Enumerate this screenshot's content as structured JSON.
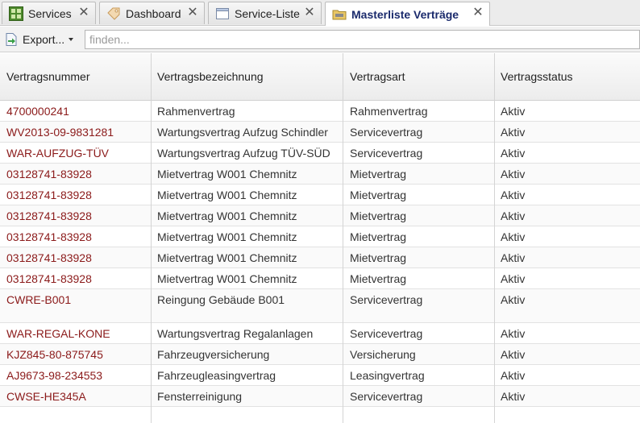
{
  "tabs": [
    {
      "label": "Services",
      "icon": "grid-icon",
      "active": false
    },
    {
      "label": "Dashboard",
      "icon": "tag-icon",
      "active": false
    },
    {
      "label": "Service-Liste",
      "icon": "window-icon",
      "active": false
    },
    {
      "label": "Masterliste Verträge",
      "icon": "folder-icon",
      "active": true
    }
  ],
  "toolbar": {
    "export_label": "Export...",
    "search_placeholder": "finden..."
  },
  "table": {
    "columns": [
      "Vertragsnummer",
      "Vertragsbezeichnung",
      "Vertragsart",
      "Vertragsstatus"
    ],
    "rows": [
      [
        "4700000241",
        "Rahmenvertrag",
        "Rahmenvertrag",
        "Aktiv"
      ],
      [
        "WV2013-09-9831281",
        "Wartungsvertrag Aufzug Schindler",
        "Servicevertrag",
        "Aktiv"
      ],
      [
        "WAR-AUFZUG-TÜV",
        "Wartungsvertrag Aufzug TÜV-SÜD",
        "Servicevertrag",
        "Aktiv"
      ],
      [
        "03128741-83928",
        "Mietvertrag W001 Chemnitz",
        "Mietvertrag",
        "Aktiv"
      ],
      [
        "03128741-83928",
        "Mietvertrag W001 Chemnitz",
        "Mietvertrag",
        "Aktiv"
      ],
      [
        "03128741-83928",
        "Mietvertrag W001 Chemnitz",
        "Mietvertrag",
        "Aktiv"
      ],
      [
        "03128741-83928",
        "Mietvertrag W001 Chemnitz",
        "Mietvertrag",
        "Aktiv"
      ],
      [
        "03128741-83928",
        "Mietvertrag W001 Chemnitz",
        "Mietvertrag",
        "Aktiv"
      ],
      [
        "03128741-83928",
        "Mietvertrag W001 Chemnitz",
        "Mietvertrag",
        "Aktiv"
      ],
      [
        "CWRE-B001",
        "Reingung Gebäude B001",
        "Servicevertrag",
        "Aktiv"
      ],
      [
        "WAR-REGAL-KONE",
        "Wartungsvertrag Regalanlagen",
        "Servicevertrag",
        "Aktiv"
      ],
      [
        "KJZ845-80-875745",
        "Fahrzeugversicherung",
        "Versicherung",
        "Aktiv"
      ],
      [
        "AJ9673-98-234553",
        "Fahrzeugleasingvertrag",
        "Leasingvertrag",
        "Aktiv"
      ],
      [
        "CWSE-HE345A",
        "Fensterreinigung",
        "Servicevertrag",
        "Aktiv"
      ]
    ]
  },
  "colors": {
    "link": "#8b1a1a",
    "active_tab_text": "#1a2a6c"
  }
}
